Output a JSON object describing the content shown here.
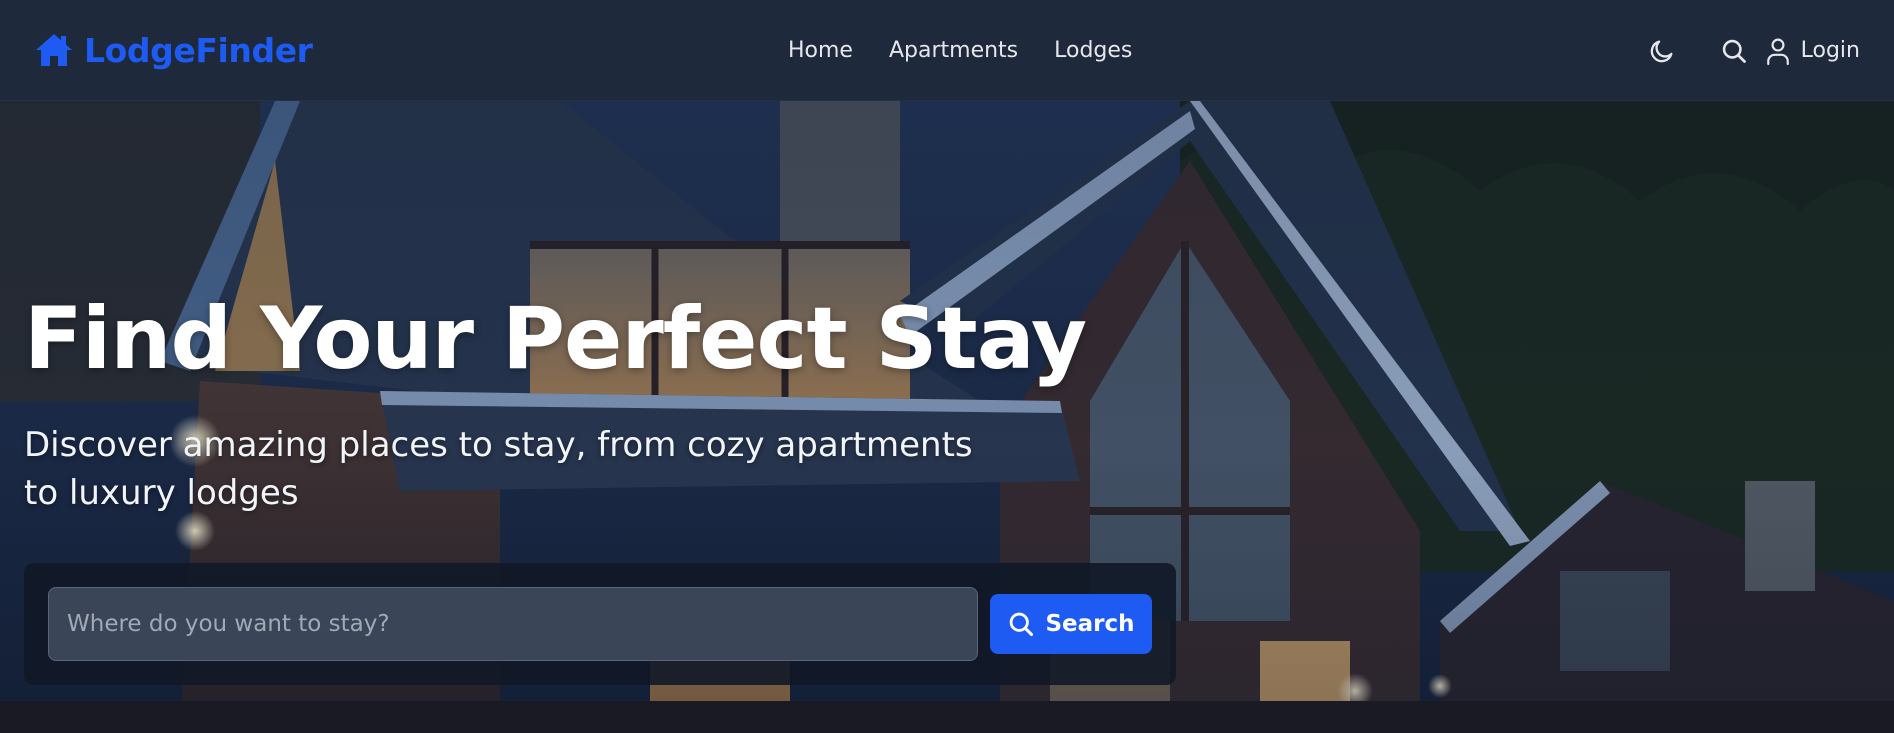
{
  "app": {
    "brand_name": "LodgeFinder",
    "brand_icon": "home-icon",
    "accent_color": "#1d5bf2"
  },
  "nav": {
    "links": [
      {
        "label": "Home"
      },
      {
        "label": "Apartments"
      },
      {
        "label": "Lodges"
      }
    ],
    "theme_toggle_icon": "moon-icon",
    "search_icon": "search-icon",
    "login_icon": "user-icon",
    "login_label": "Login"
  },
  "hero": {
    "title": "Find Your Perfect Stay",
    "subtitle": "Discover amazing places to stay, from cozy apartments to luxury lodges",
    "search": {
      "placeholder": "Where do you want to stay?",
      "value": "",
      "button_label": "Search",
      "button_icon": "search-icon"
    }
  }
}
